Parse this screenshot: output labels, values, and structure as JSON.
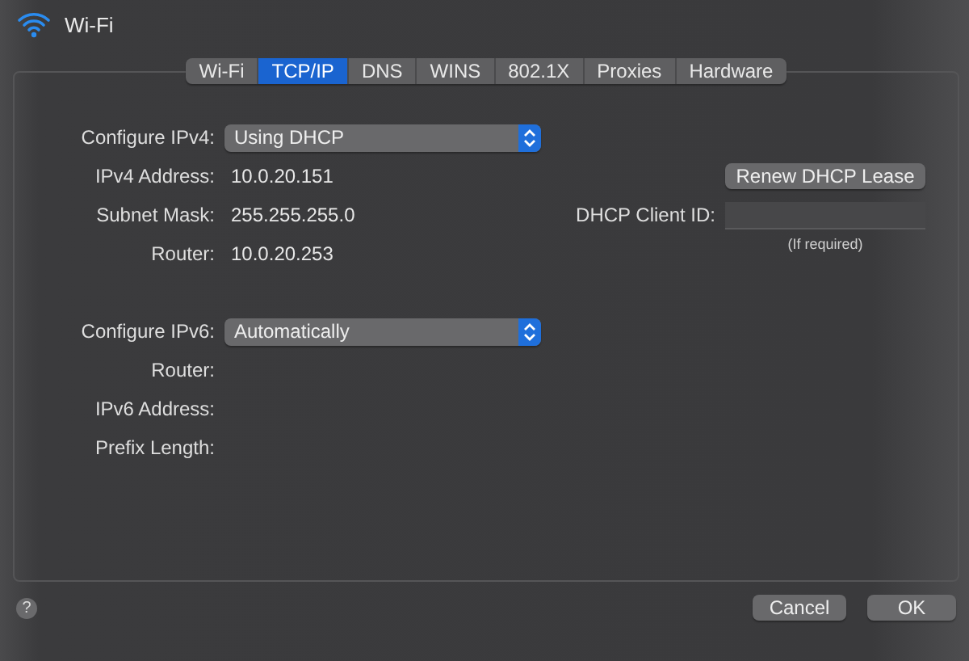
{
  "window": {
    "title": "Wi-Fi"
  },
  "tabs": [
    {
      "label": "Wi-Fi",
      "selected": false
    },
    {
      "label": "TCP/IP",
      "selected": true
    },
    {
      "label": "DNS",
      "selected": false
    },
    {
      "label": "WINS",
      "selected": false
    },
    {
      "label": "802.1X",
      "selected": false
    },
    {
      "label": "Proxies",
      "selected": false
    },
    {
      "label": "Hardware",
      "selected": false
    }
  ],
  "ipv4": {
    "configure": {
      "label": "Configure IPv4:",
      "value": "Using DHCP"
    },
    "fields": [
      {
        "label": "IPv4 Address:",
        "value": "10.0.20.151"
      },
      {
        "label": "Subnet Mask:",
        "value": "255.255.255.0"
      },
      {
        "label": "Router:",
        "value": "10.0.20.253"
      }
    ]
  },
  "renew_button": "Renew DHCP Lease",
  "dhcp_client_id": {
    "label": "DHCP Client ID:",
    "note": "(If required)"
  },
  "ipv6": {
    "configure": {
      "label": "Configure IPv6:",
      "value": "Automatically"
    },
    "fields": [
      {
        "label": "Router:"
      },
      {
        "label": "IPv6 Address:"
      },
      {
        "label": "Prefix Length:"
      }
    ]
  },
  "help": "?",
  "buttons": [
    "Cancel",
    "OK"
  ]
}
